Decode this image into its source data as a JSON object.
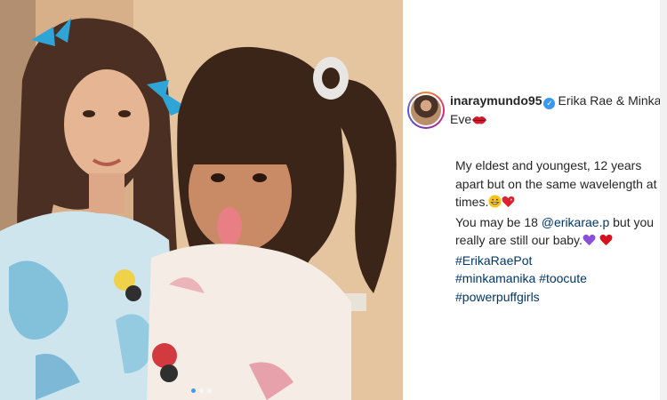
{
  "post": {
    "username": "inaraymundo95",
    "verified_icon": "verified-badge-icon",
    "title_text": "Erika Rae & Minka Eve",
    "title_emoji": "lips-emoji",
    "line1": "My eldest and youngest, 12 years apart but on the same wavelength at times.",
    "line1_emoji": [
      "grinning-face-emoji",
      "sparkling-heart-emoji"
    ],
    "line2_prefix": "You may be 18",
    "mention": "@erikarae.p",
    "line2_suffix": "but you really are still our baby.",
    "line2_emoji": [
      "purple-heart-emoji",
      "red-heart-emoji"
    ],
    "hashtags": [
      "#ErikaRaePot",
      "#minkamanika",
      "#toocute",
      "#powerpuffgirls"
    ]
  },
  "photo": {
    "description_icon": "post-photo",
    "carousel_count": 3,
    "carousel_active": 1
  },
  "colors": {
    "link": "#00376b",
    "verified": "#3897f0",
    "text": "#262626"
  }
}
